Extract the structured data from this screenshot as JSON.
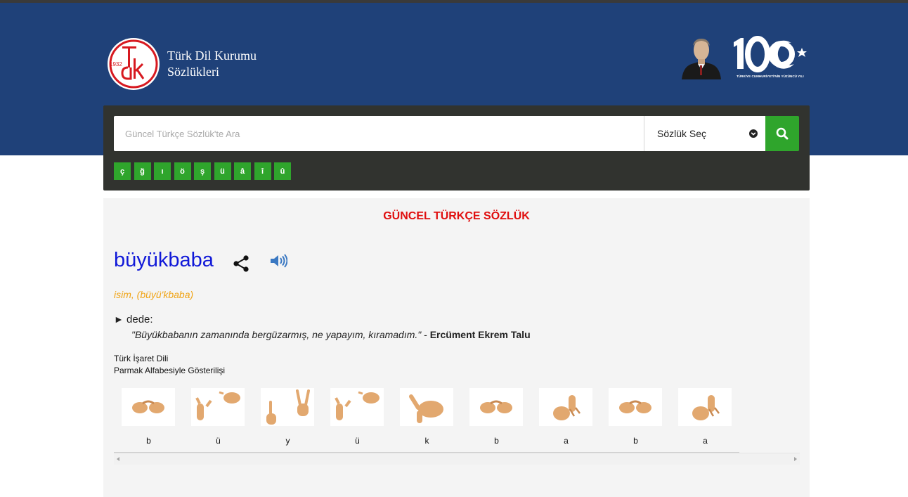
{
  "header": {
    "org_line1": "Türk Dil Kurumu",
    "org_line2": "Sözlükleri",
    "logo_year": "1932",
    "centenary_text": "TÜRKİYE CUMHURİYETİ'NİN YÜZÜNCÜ YILI",
    "background_color": "#1f4179"
  },
  "search": {
    "placeholder": "Güncel Türkçe Sözlük'te Ara",
    "value": "",
    "dictionary_select_label": "Sözlük Seç",
    "button_icon": "search-icon",
    "special_chars": [
      "ç",
      "ğ",
      "ı",
      "ö",
      "ş",
      "ü",
      "â",
      "î",
      "û"
    ],
    "accent_color": "#2fa52c"
  },
  "entry": {
    "dictionary_title": "GÜNCEL TÜRKÇE SÖZLÜK",
    "headword": "büyükbaba",
    "part_of_speech": "isim, (büyü'kbaba)",
    "meaning_marker": "►",
    "meaning": "dede:",
    "example_quote": "\"Büyükbabanın zamanında bergüzarmış, ne yapayım, kıramadım.\"",
    "example_separator": " - ",
    "example_author": "Ercüment Ekrem Talu",
    "title_color": "#e00f0f",
    "headword_color": "#1018d8",
    "pos_color": "#f0a416"
  },
  "sign_language": {
    "title_line1": "Türk İşaret Dili",
    "title_line2": "Parmak Alfabesiyle Gösterilişi",
    "letters": [
      "b",
      "ü",
      "y",
      "ü",
      "k",
      "b",
      "a",
      "b",
      "a"
    ]
  }
}
